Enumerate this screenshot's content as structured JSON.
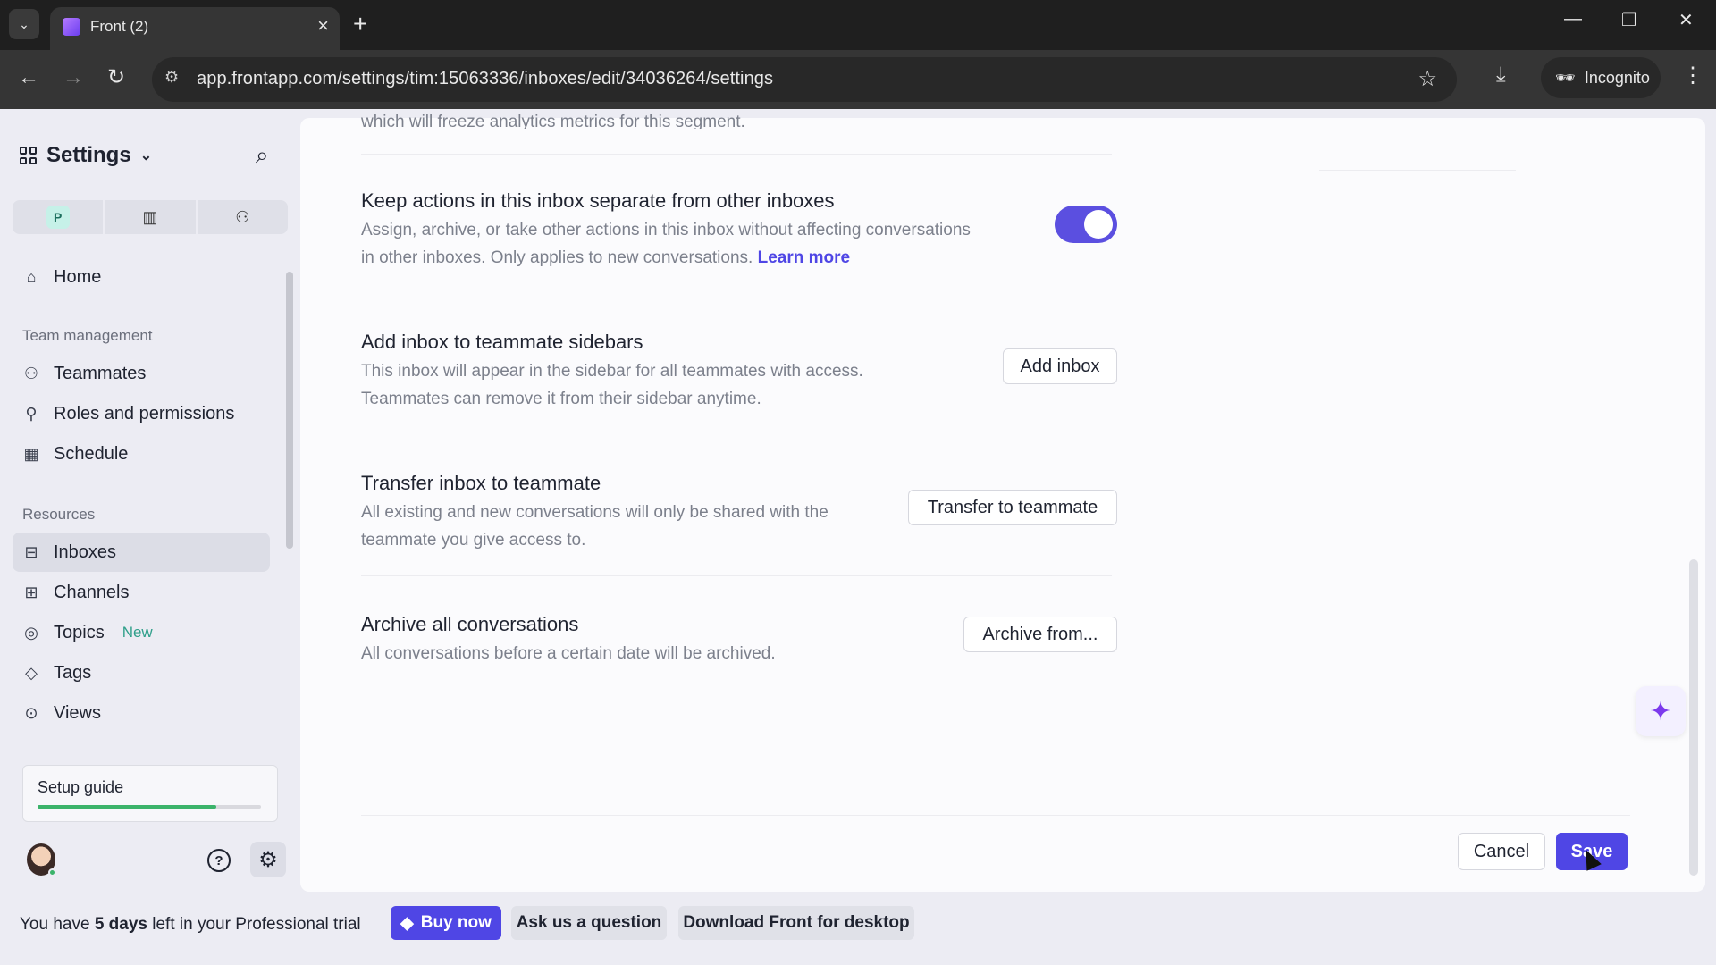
{
  "browser": {
    "tab_title": "Front (2)",
    "url": "app.frontapp.com/settings/tim:15063336/inboxes/edit/34036264/settings",
    "incognito_label": "Incognito"
  },
  "sidebar": {
    "title": "Settings",
    "scope_badge": "P",
    "home": "Home",
    "team_section": "Team management",
    "team_items": [
      "Teammates",
      "Roles and permissions",
      "Schedule"
    ],
    "resources_section": "Resources",
    "resource_items": [
      "Inboxes",
      "Channels",
      "Topics",
      "Tags",
      "Views"
    ],
    "topics_badge": "New",
    "active_item": "Inboxes",
    "setup_guide": "Setup guide",
    "setup_progress": 0.8
  },
  "main": {
    "cut_text": "which will freeze analytics metrics for this segment.",
    "rows": [
      {
        "title": "Keep actions in this inbox separate from other inboxes",
        "desc_line1": "Assign, archive, or take other actions in this inbox without affecting conversations",
        "desc_line2": "in other inboxes. Only applies to new conversations.",
        "link": "Learn more",
        "toggle_on": true
      },
      {
        "title": "Add inbox to teammate sidebars",
        "desc_line1": "This inbox will appear in the sidebar for all teammates with access.",
        "desc_line2": "Teammates can remove it from their sidebar anytime.",
        "button": "Add inbox"
      },
      {
        "title": "Transfer inbox to teammate",
        "desc_line1": "All existing and new conversations will only be shared with the",
        "desc_line2": "teammate you give access to.",
        "button": "Transfer to teammate"
      },
      {
        "title": "Archive all conversations",
        "desc_line1": "All conversations before a certain date will be archived.",
        "button": "Archive from..."
      }
    ],
    "cancel": "Cancel",
    "save": "Save"
  },
  "trial": {
    "prefix": "You have ",
    "days": "5 days",
    "suffix": " left in your Professional trial",
    "buy": "Buy now",
    "ask": "Ask us a question",
    "download": "Download Front for desktop"
  },
  "colors": {
    "accent": "#4f46e5",
    "toggle": "#5b4fe0",
    "progress": "#3bb36a"
  }
}
